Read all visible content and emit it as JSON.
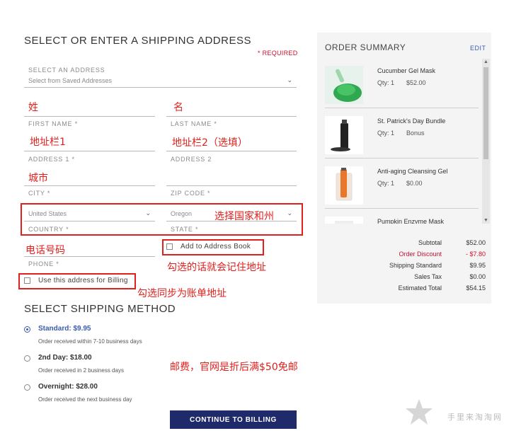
{
  "shipping": {
    "title": "SELECT OR ENTER A SHIPPING ADDRESS",
    "required": "* REQUIRED",
    "address_select": {
      "label": "SELECT AN ADDRESS",
      "value": "Select from Saved Addresses"
    },
    "first_name": {
      "label": "FIRST NAME *",
      "value": ""
    },
    "last_name": {
      "label": "LAST NAME *",
      "value": ""
    },
    "address1": {
      "label": "ADDRESS 1 *",
      "value": ""
    },
    "address2": {
      "label": "ADDRESS 2",
      "value": ""
    },
    "city": {
      "label": "CITY *",
      "value": ""
    },
    "zip": {
      "label": "ZIP CODE *",
      "value": ""
    },
    "country": {
      "label": "COUNTRY *",
      "value": "United States"
    },
    "state": {
      "label": "STATE *",
      "value": "Oregon"
    },
    "phone": {
      "label": "PHONE *",
      "value": ""
    },
    "add_to_book": "Add to Address Book",
    "use_for_billing": "Use this address for Billing"
  },
  "method": {
    "title": "SELECT SHIPPING METHOD",
    "options": [
      {
        "name": "Standard: $9.95",
        "desc": "Order received within 7-10 business days",
        "selected": true
      },
      {
        "name": "2nd Day: $18.00",
        "desc": "Order received in 2 business days",
        "selected": false
      },
      {
        "name": "Overnight: $28.00",
        "desc": "Order received the next business day",
        "selected": false
      }
    ]
  },
  "continue_button": "CONTINUE TO BILLING",
  "summary": {
    "title": "ORDER SUMMARY",
    "edit": "EDIT",
    "items": [
      {
        "name": "Cucumber Gel Mask",
        "qty_label": "Qty: 1",
        "price": "$52.00"
      },
      {
        "name": "St. Patrick's Day Bundle",
        "qty_label": "Qty: 1",
        "price": "Bonus"
      },
      {
        "name": "Anti-aging Cleansing Gel",
        "qty_label": "Qty: 1",
        "price": "$0.00"
      },
      {
        "name": "Pumpkin Enzyme Mask",
        "qty_label": "",
        "price": ""
      }
    ],
    "totals": [
      {
        "label": "Subtotal",
        "value": "$52.00"
      },
      {
        "label": "Order Discount",
        "value": "- $7.80"
      },
      {
        "label": "Shipping Standard",
        "value": "$9.95"
      },
      {
        "label": "Sales Tax",
        "value": "$0.00"
      },
      {
        "label": "Estimated Total",
        "value": "$54.15"
      }
    ]
  },
  "annotations": {
    "surname": "姓",
    "given_name": "名",
    "address1": "地址栏1",
    "address2": "地址栏2（选填）",
    "city": "城市",
    "country_state": "选择国家和州",
    "phone": "电话号码",
    "remember": "勾选的话就会记住地址",
    "billing_sync": "勾选同步为账单地址",
    "shipping_fee": "邮费，官网是折后满$50免邮"
  },
  "watermark": "手里来淘淘网",
  "colors": {
    "accent": "#3a5bb0",
    "button": "#1f2a6b",
    "required": "#c8102e",
    "annotation": "#e0201c"
  }
}
